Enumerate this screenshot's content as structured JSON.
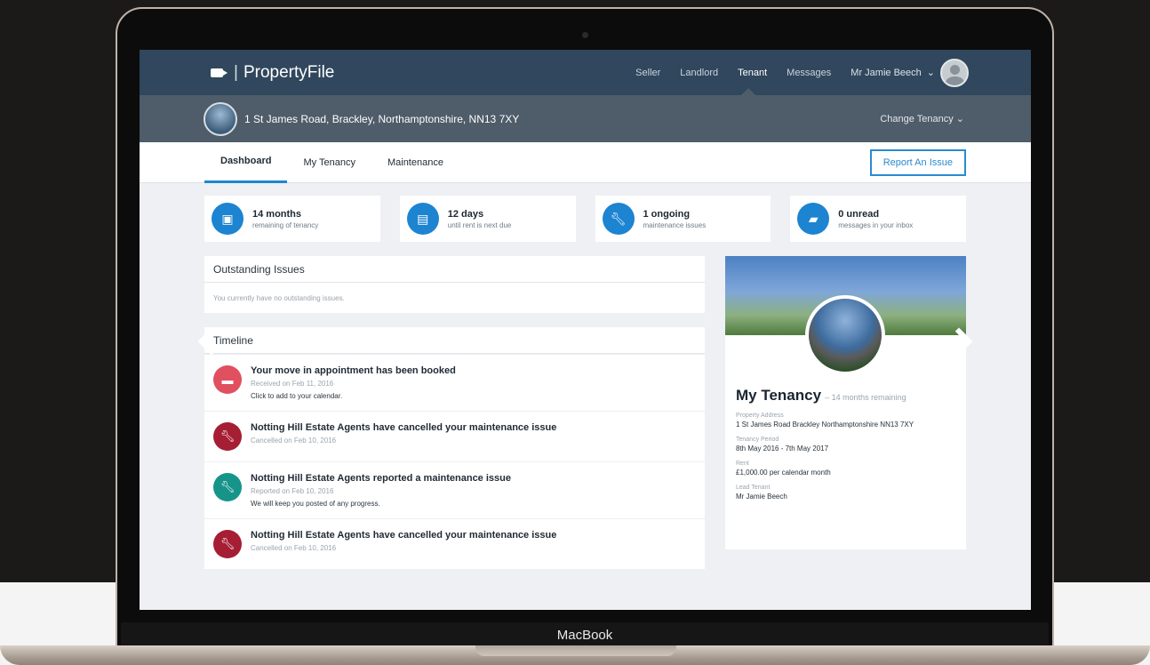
{
  "app": {
    "brand": "PropertyFile",
    "device_label": "MacBook"
  },
  "nav": {
    "items": [
      "Seller",
      "Landlord",
      "Tenant",
      "Messages"
    ],
    "active": "Tenant",
    "user": "Mr Jamie Beech"
  },
  "address_bar": {
    "address": "1 St James Road, Brackley, Northamptonshire, NN13 7XY",
    "change_label": "Change Tenancy"
  },
  "subnav": {
    "tabs": [
      "Dashboard",
      "My Tenancy",
      "Maintenance"
    ],
    "active": "Dashboard",
    "report_button": "Report An Issue"
  },
  "stats": [
    {
      "value": "14 months",
      "label": "remaining of tenancy",
      "icon": "calendar-icon"
    },
    {
      "value": "12 days",
      "label": "until rent is next due",
      "icon": "card-icon"
    },
    {
      "value": "1 ongoing",
      "label": "maintenance issues",
      "icon": "wrench-icon"
    },
    {
      "value": "0 unread",
      "label": "messages in your inbox",
      "icon": "chat-icon"
    }
  ],
  "outstanding": {
    "title": "Outstanding Issues",
    "empty_text": "You currently have no outstanding issues."
  },
  "timeline": {
    "title": "Timeline",
    "items": [
      {
        "title": "Your move in appointment has been booked",
        "date": "Received on Feb 11, 2016",
        "desc": "Click to add to your calendar.",
        "color": "#e0505f",
        "icon": "truck-icon"
      },
      {
        "title": "Notting Hill Estate Agents have cancelled your maintenance issue",
        "date": "Cancelled on Feb 10, 2016",
        "desc": "",
        "color": "#a51e33",
        "icon": "wrench-icon"
      },
      {
        "title": "Notting Hill Estate Agents reported a maintenance issue",
        "date": "Reported on Feb 10, 2016",
        "desc": "We will keep you posted of any progress.",
        "color": "#16948a",
        "icon": "wrench-icon"
      },
      {
        "title": "Notting Hill Estate Agents have cancelled your maintenance issue",
        "date": "Cancelled on Feb 10, 2016",
        "desc": "",
        "color": "#a51e33",
        "icon": "wrench-icon"
      }
    ]
  },
  "tenancy_card": {
    "title": "My Tenancy",
    "subtitle": "– 14 months remaining",
    "fields": [
      {
        "label": "Property Address",
        "value": "1 St James Road Brackley Northamptonshire NN13 7XY"
      },
      {
        "label": "Tenancy Period",
        "value": "8th May 2016 - 7th May 2017"
      },
      {
        "label": "Rent",
        "value": "£1,000.00 per calendar month"
      },
      {
        "label": "Lead Tenant",
        "value": "Mr Jamie Beech"
      }
    ]
  }
}
